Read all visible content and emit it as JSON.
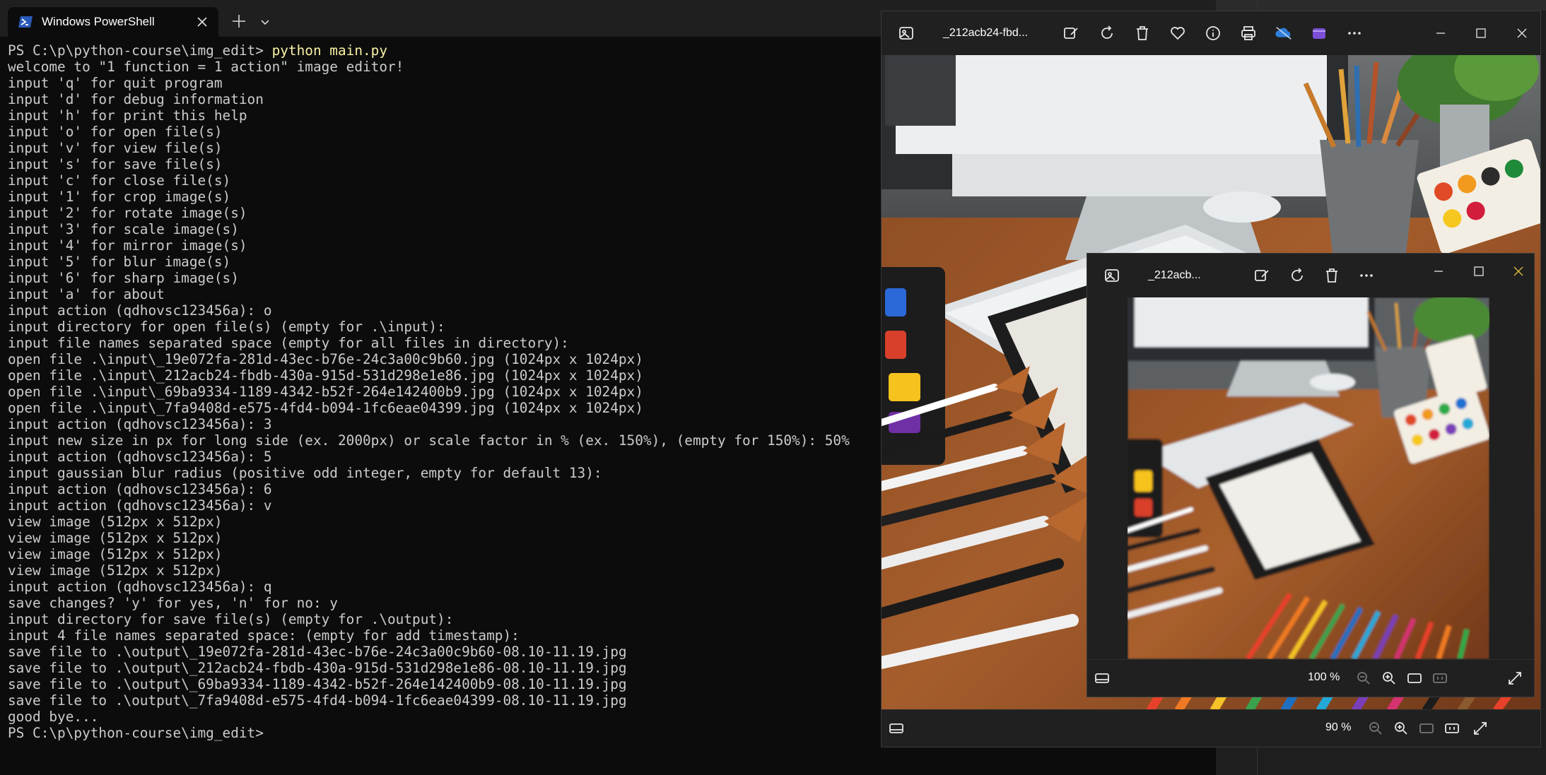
{
  "terminal": {
    "tab_title": "Windows PowerShell",
    "icons": {
      "app": "powershell-icon",
      "close": "close-icon",
      "new_tab": "plus-icon",
      "dropdown": "chevron-down-icon"
    },
    "prompt": "PS C:\\p\\python-course\\img_edit> ",
    "command": "python main.py",
    "output": "\nwelcome to \"1 function = 1 action\" image editor!\ninput 'q' for quit program\ninput 'd' for debug information\ninput 'h' for print this help\ninput 'o' for open file(s)\ninput 'v' for view file(s)\ninput 's' for save file(s)\ninput 'c' for close file(s)\ninput '1' for crop image(s)\ninput '2' for rotate image(s)\ninput '3' for scale image(s)\ninput '4' for mirror image(s)\ninput '5' for blur image(s)\ninput '6' for sharp image(s)\ninput 'a' for about\ninput action (qdhovsc123456a): o\ninput directory for open file(s) (empty for .\\input):\ninput file names separated space (empty for all files in directory):\nopen file .\\input\\_19e072fa-281d-43ec-b76e-24c3a00c9b60.jpg (1024px x 1024px)\nopen file .\\input\\_212acb24-fbdb-430a-915d-531d298e1e86.jpg (1024px x 1024px)\nopen file .\\input\\_69ba9334-1189-4342-b52f-264e142400b9.jpg (1024px x 1024px)\nopen file .\\input\\_7fa9408d-e575-4fd4-b094-1fc6eae04399.jpg (1024px x 1024px)\ninput action (qdhovsc123456a): 3\ninput new size in px for long side (ex. 2000px) or scale factor in % (ex. 150%), (empty for 150%): 50%\ninput action (qdhovsc123456a): 5\ninput gaussian blur radius (positive odd integer, empty for default 13):\ninput action (qdhovsc123456a): 6\ninput action (qdhovsc123456a): v\nview image (512px x 512px)\nview image (512px x 512px)\nview image (512px x 512px)\nview image (512px x 512px)\ninput action (qdhovsc123456a): q\nsave changes? 'y' for yes, 'n' for no: y\ninput directory for save file(s) (empty for .\\output):\ninput 4 file names separated space: (empty for add timestamp):\nsave file to .\\output\\_19e072fa-281d-43ec-b76e-24c3a00c9b60-08.10-11.19.jpg\nsave file to .\\output\\_212acb24-fbdb-430a-915d-531d298e1e86-08.10-11.19.jpg\nsave file to .\\output\\_69ba9334-1189-4342-b52f-264e142400b9-08.10-11.19.jpg\nsave file to .\\output\\_7fa9408d-e575-4fd4-b094-1fc6eae04399-08.10-11.19.jpg\ngood bye...\n",
    "final_prompt": "PS C:\\p\\python-course\\img_edit>"
  },
  "viewer_large": {
    "file_name": "_212acb24-fbd...",
    "zoom": "90 %",
    "toolbar_icons": [
      "gallery-icon",
      "edit-icon",
      "rotate-icon",
      "delete-icon",
      "favorite-icon",
      "info-icon",
      "print-icon",
      "onedrive-icon",
      "clipchamp-icon",
      "more-icon"
    ],
    "window_icons": [
      "minimize-icon",
      "maximize-icon",
      "close-icon"
    ],
    "status_icons": [
      "filmstrip-icon",
      "zoom-out-icon",
      "zoom-in-icon",
      "fit-icon",
      "actual-size-icon",
      "fullscreen-icon"
    ],
    "image_subject": "art desk with computer, keyboard, paint brushes, pencils and palette"
  },
  "viewer_small": {
    "file_name": "_212acb...",
    "zoom": "100 %",
    "toolbar_icons": [
      "gallery-icon",
      "edit-icon",
      "rotate-icon",
      "delete-icon",
      "more-icon"
    ],
    "window_icons": [
      "minimize-icon",
      "maximize-icon",
      "close-icon"
    ],
    "status_icons": [
      "filmstrip-icon",
      "zoom-out-icon",
      "zoom-in-icon",
      "fit-icon",
      "actual-size-icon",
      "fullscreen-icon"
    ],
    "close_accent": "#e3c23a"
  },
  "colors": {
    "command": "#f9f1a5",
    "text": "#cccccc",
    "background": "#0c0c0c"
  }
}
